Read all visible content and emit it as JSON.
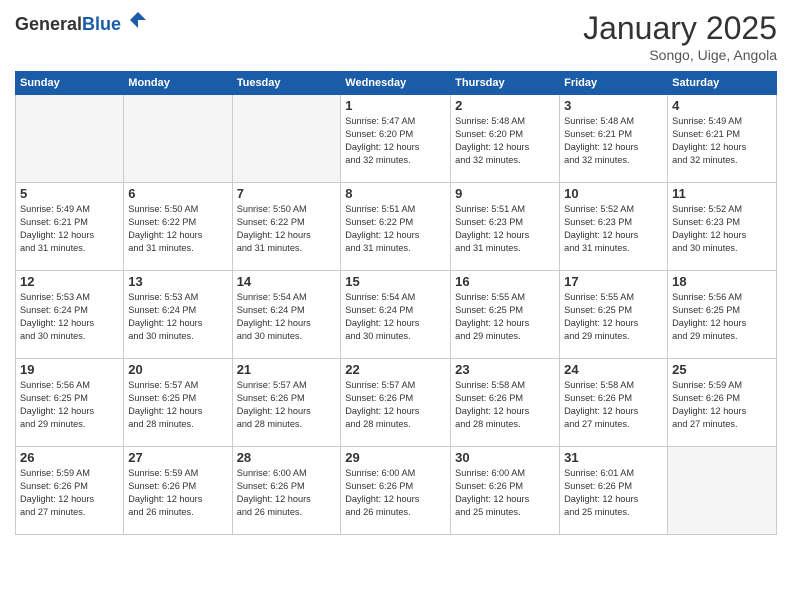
{
  "header": {
    "logo_general": "General",
    "logo_blue": "Blue",
    "month_title": "January 2025",
    "location": "Songo, Uige, Angola"
  },
  "weekdays": [
    "Sunday",
    "Monday",
    "Tuesday",
    "Wednesday",
    "Thursday",
    "Friday",
    "Saturday"
  ],
  "weeks": [
    [
      {
        "day": "",
        "info": ""
      },
      {
        "day": "",
        "info": ""
      },
      {
        "day": "",
        "info": ""
      },
      {
        "day": "1",
        "info": "Sunrise: 5:47 AM\nSunset: 6:20 PM\nDaylight: 12 hours\nand 32 minutes."
      },
      {
        "day": "2",
        "info": "Sunrise: 5:48 AM\nSunset: 6:20 PM\nDaylight: 12 hours\nand 32 minutes."
      },
      {
        "day": "3",
        "info": "Sunrise: 5:48 AM\nSunset: 6:21 PM\nDaylight: 12 hours\nand 32 minutes."
      },
      {
        "day": "4",
        "info": "Sunrise: 5:49 AM\nSunset: 6:21 PM\nDaylight: 12 hours\nand 32 minutes."
      }
    ],
    [
      {
        "day": "5",
        "info": "Sunrise: 5:49 AM\nSunset: 6:21 PM\nDaylight: 12 hours\nand 31 minutes."
      },
      {
        "day": "6",
        "info": "Sunrise: 5:50 AM\nSunset: 6:22 PM\nDaylight: 12 hours\nand 31 minutes."
      },
      {
        "day": "7",
        "info": "Sunrise: 5:50 AM\nSunset: 6:22 PM\nDaylight: 12 hours\nand 31 minutes."
      },
      {
        "day": "8",
        "info": "Sunrise: 5:51 AM\nSunset: 6:22 PM\nDaylight: 12 hours\nand 31 minutes."
      },
      {
        "day": "9",
        "info": "Sunrise: 5:51 AM\nSunset: 6:23 PM\nDaylight: 12 hours\nand 31 minutes."
      },
      {
        "day": "10",
        "info": "Sunrise: 5:52 AM\nSunset: 6:23 PM\nDaylight: 12 hours\nand 31 minutes."
      },
      {
        "day": "11",
        "info": "Sunrise: 5:52 AM\nSunset: 6:23 PM\nDaylight: 12 hours\nand 30 minutes."
      }
    ],
    [
      {
        "day": "12",
        "info": "Sunrise: 5:53 AM\nSunset: 6:24 PM\nDaylight: 12 hours\nand 30 minutes."
      },
      {
        "day": "13",
        "info": "Sunrise: 5:53 AM\nSunset: 6:24 PM\nDaylight: 12 hours\nand 30 minutes."
      },
      {
        "day": "14",
        "info": "Sunrise: 5:54 AM\nSunset: 6:24 PM\nDaylight: 12 hours\nand 30 minutes."
      },
      {
        "day": "15",
        "info": "Sunrise: 5:54 AM\nSunset: 6:24 PM\nDaylight: 12 hours\nand 30 minutes."
      },
      {
        "day": "16",
        "info": "Sunrise: 5:55 AM\nSunset: 6:25 PM\nDaylight: 12 hours\nand 29 minutes."
      },
      {
        "day": "17",
        "info": "Sunrise: 5:55 AM\nSunset: 6:25 PM\nDaylight: 12 hours\nand 29 minutes."
      },
      {
        "day": "18",
        "info": "Sunrise: 5:56 AM\nSunset: 6:25 PM\nDaylight: 12 hours\nand 29 minutes."
      }
    ],
    [
      {
        "day": "19",
        "info": "Sunrise: 5:56 AM\nSunset: 6:25 PM\nDaylight: 12 hours\nand 29 minutes."
      },
      {
        "day": "20",
        "info": "Sunrise: 5:57 AM\nSunset: 6:25 PM\nDaylight: 12 hours\nand 28 minutes."
      },
      {
        "day": "21",
        "info": "Sunrise: 5:57 AM\nSunset: 6:26 PM\nDaylight: 12 hours\nand 28 minutes."
      },
      {
        "day": "22",
        "info": "Sunrise: 5:57 AM\nSunset: 6:26 PM\nDaylight: 12 hours\nand 28 minutes."
      },
      {
        "day": "23",
        "info": "Sunrise: 5:58 AM\nSunset: 6:26 PM\nDaylight: 12 hours\nand 28 minutes."
      },
      {
        "day": "24",
        "info": "Sunrise: 5:58 AM\nSunset: 6:26 PM\nDaylight: 12 hours\nand 27 minutes."
      },
      {
        "day": "25",
        "info": "Sunrise: 5:59 AM\nSunset: 6:26 PM\nDaylight: 12 hours\nand 27 minutes."
      }
    ],
    [
      {
        "day": "26",
        "info": "Sunrise: 5:59 AM\nSunset: 6:26 PM\nDaylight: 12 hours\nand 27 minutes."
      },
      {
        "day": "27",
        "info": "Sunrise: 5:59 AM\nSunset: 6:26 PM\nDaylight: 12 hours\nand 26 minutes."
      },
      {
        "day": "28",
        "info": "Sunrise: 6:00 AM\nSunset: 6:26 PM\nDaylight: 12 hours\nand 26 minutes."
      },
      {
        "day": "29",
        "info": "Sunrise: 6:00 AM\nSunset: 6:26 PM\nDaylight: 12 hours\nand 26 minutes."
      },
      {
        "day": "30",
        "info": "Sunrise: 6:00 AM\nSunset: 6:26 PM\nDaylight: 12 hours\nand 25 minutes."
      },
      {
        "day": "31",
        "info": "Sunrise: 6:01 AM\nSunset: 6:26 PM\nDaylight: 12 hours\nand 25 minutes."
      },
      {
        "day": "",
        "info": ""
      }
    ]
  ]
}
